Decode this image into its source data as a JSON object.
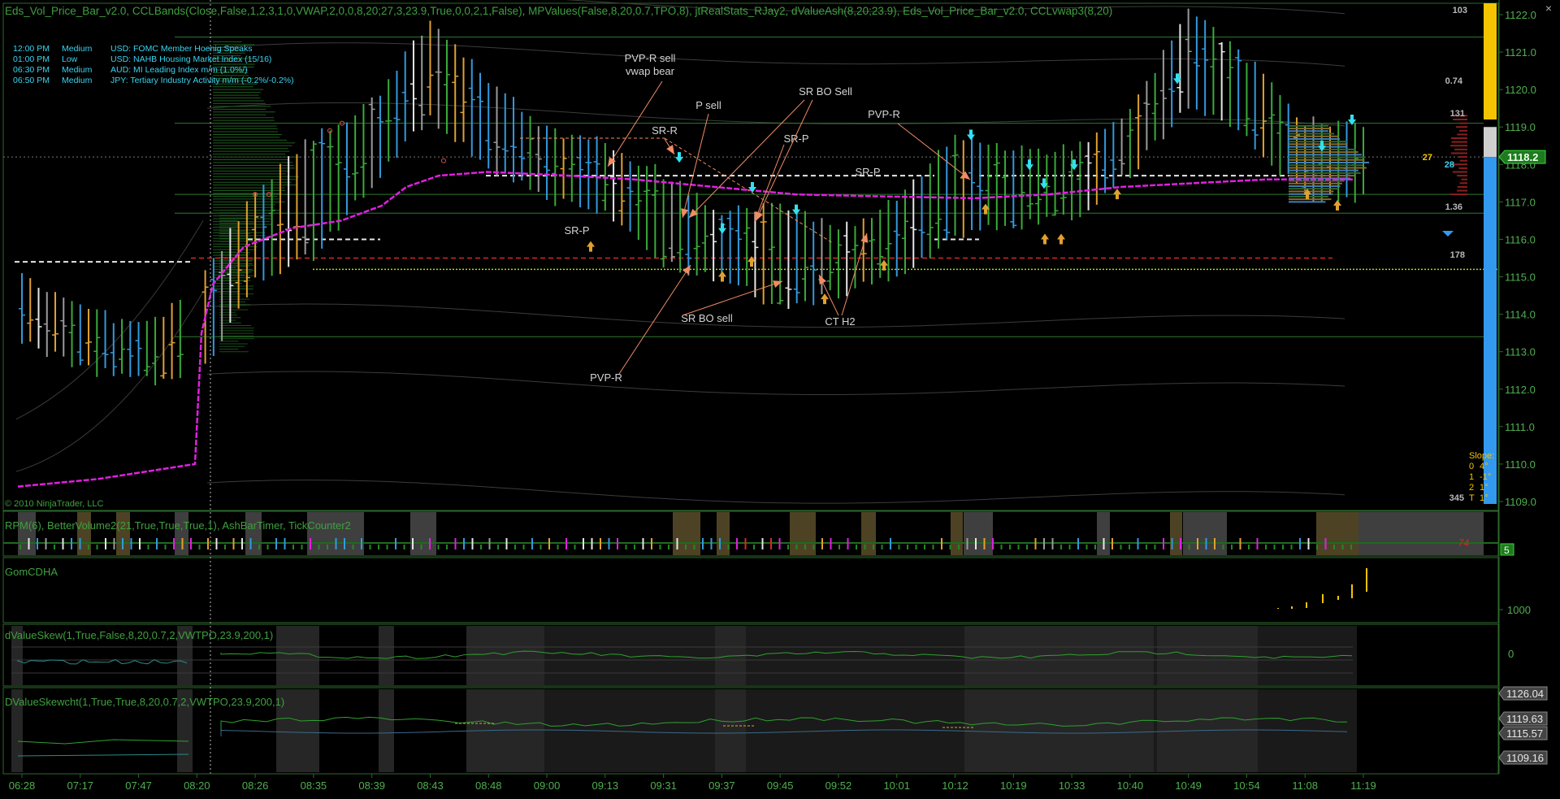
{
  "header": {
    "indicators": "Eds_Vol_Price_Bar_v2.0, CCLBands(Close,False,1,2,3,1,0,VWAP,2,0,0,8,20;27,3,23.9,True,0,0,2,1,False), MPValues(False,8,20,0.7,TPO,8), jtRealStats_RJay2, dValueAsh(8,20;23.9), Eds_Vol_Price_Bar_v2.0, CCLvwap3(8,20)",
    "copyright": "© 2010 NinjaTrader, LLC"
  },
  "news": [
    {
      "time": "12:00 PM",
      "impact": "Medium",
      "text": "USD: FOMC Member Hoenig Speaks"
    },
    {
      "time": "01:00 PM",
      "impact": "Low",
      "text": "USD: NAHB Housing Market Index (15/16)"
    },
    {
      "time": "06:30 PM",
      "impact": "Medium",
      "text": "AUD: MI Leading Index m/m (1.0%/)"
    },
    {
      "time": "06:50 PM",
      "impact": "Medium",
      "text": "JPY: Tertiary Industry Activity m/m (-0.2%/-0.2%)"
    }
  ],
  "right_stats": {
    "top": "103",
    "v1": "0.74",
    "v2": "131",
    "v3": "27",
    "v4": "28",
    "v5": "1.36",
    "v6": "178",
    "v7": "345",
    "v7b": "T",
    "v7c": "1°"
  },
  "slope": {
    "label": "Slope:",
    "rows": [
      [
        "0",
        "4°"
      ],
      [
        "1",
        "-1°"
      ],
      [
        "2",
        "1°"
      ]
    ]
  },
  "panels": {
    "p2": {
      "title": "RPM(6), BetterVolume2(21,True,True,True,1), AshBarTimer, TickCounter2",
      "badge": "5",
      "timer": "74"
    },
    "p3": {
      "title": "GomCDHA",
      "label": "1000"
    },
    "p4": {
      "title": "dValueSkew(1,True,False,8,20,0.7,2,VWTPO,23.9,200,1)",
      "label": "0"
    },
    "p5": {
      "title": "DValueSkewcht(1,True,True,8,20,0.7,2,VWTPO,23.9,200,1)",
      "labels": [
        "1126.04",
        "1119.63",
        "1115.57",
        "1109.16"
      ]
    }
  },
  "colors": {
    "green": "#3aaa3a",
    "blue": "#3399dd",
    "white": "#e6e6e6",
    "orange": "#e0a030",
    "red": "#d62828",
    "magenta": "#e020e0",
    "lime": "#a8d830",
    "salmon": "#f08c64",
    "cyan": "#33e0f0",
    "yellow": "#f4c400",
    "gray": "#9a9a9a"
  },
  "chart_data": {
    "type": "ohlc",
    "ylim": [
      1109,
      1122
    ],
    "y_ticks": [
      "1109.0",
      "1110.0",
      "1111.0",
      "1112.0",
      "1113.0",
      "1114.0",
      "1115.0",
      "1116.0",
      "1117.0",
      "1118.0",
      "1119.0",
      "1120.0",
      "1121.0",
      "1122.0"
    ],
    "current_price": "1118.2",
    "x_ticks": [
      "06:28",
      "07:17",
      "07:47",
      "08:20",
      "08:26",
      "08:35",
      "08:39",
      "08:43",
      "08:48",
      "09:00",
      "09:13",
      "09:31",
      "09:37",
      "09:45",
      "09:52",
      "10:01",
      "10:12",
      "10:19",
      "10:33",
      "10:40",
      "10:49",
      "10:54",
      "11:08",
      "11:19"
    ],
    "annotations": [
      {
        "text": "PVP-R sell",
        "x": "09:13",
        "y": 1120.9
      },
      {
        "text": "vwap bear",
        "x": "09:13",
        "y": 1120.6
      },
      {
        "text": "P sell",
        "x": "09:31",
        "y": 1119.6
      },
      {
        "text": "SR BO Sell",
        "x": "09:45",
        "y": 1119.9
      },
      {
        "text": "SR-R",
        "x": "09:13",
        "y": 1118.8
      },
      {
        "text": "SR-P",
        "x": "09:45",
        "y": 1118.6
      },
      {
        "text": "PVP-R",
        "x": "10:01",
        "y": 1119.1
      },
      {
        "text": "SR-P",
        "x": "10:01",
        "y": 1117.6
      },
      {
        "text": "SR-P",
        "x": "09:00",
        "y": 1116.1
      },
      {
        "text": "SR BO sell",
        "x": "09:31",
        "y": 1114.2
      },
      {
        "text": "CT H2",
        "x": "09:52",
        "y": 1113.9
      },
      {
        "text": "PVP-R",
        "x": "09:13",
        "y": 1112.7
      }
    ],
    "levels": [
      {
        "name": "white-dashed",
        "values": [
          1115.4,
          1116.0,
          1117.7
        ]
      },
      {
        "name": "red-dashed",
        "values": [
          1115.5
        ]
      },
      {
        "name": "yellow-dotted",
        "values": [
          1115.2
        ]
      },
      {
        "name": "green-lines",
        "values": [
          1113.4,
          1116.7,
          1117.2,
          1119.1,
          1121.4
        ]
      }
    ],
    "ohlc_samples": [
      {
        "t": "06:28",
        "o": 1114.2,
        "h": 1114.8,
        "l": 1113.5,
        "c": 1113.8
      },
      {
        "t": "07:17",
        "o": 1113.5,
        "h": 1114.1,
        "l": 1112.7,
        "c": 1113.0
      },
      {
        "t": "07:47",
        "o": 1113.0,
        "h": 1113.5,
        "l": 1112.4,
        "c": 1112.9
      },
      {
        "t": "08:20",
        "o": 1112.8,
        "h": 1114.5,
        "l": 1112.4,
        "c": 1114.4
      },
      {
        "t": "08:26",
        "o": 1115.3,
        "h": 1117.2,
        "l": 1115.1,
        "c": 1116.8
      },
      {
        "t": "08:35",
        "o": 1116.0,
        "h": 1118.6,
        "l": 1115.7,
        "c": 1118.2
      },
      {
        "t": "08:39",
        "o": 1117.9,
        "h": 1119.5,
        "l": 1117.6,
        "c": 1119.3
      },
      {
        "t": "08:43",
        "o": 1119.8,
        "h": 1121.7,
        "l": 1119.4,
        "c": 1120.3
      },
      {
        "t": "08:48",
        "o": 1119.6,
        "h": 1120.1,
        "l": 1118.1,
        "c": 1118.5
      },
      {
        "t": "09:00",
        "o": 1118.4,
        "h": 1118.8,
        "l": 1117.2,
        "c": 1117.6
      },
      {
        "t": "09:13",
        "o": 1117.9,
        "h": 1118.4,
        "l": 1116.9,
        "c": 1117.2
      },
      {
        "t": "09:31",
        "o": 1117.0,
        "h": 1117.6,
        "l": 1115.5,
        "c": 1115.8
      },
      {
        "t": "09:37",
        "o": 1115.8,
        "h": 1116.6,
        "l": 1115.1,
        "c": 1116.2
      },
      {
        "t": "09:45",
        "o": 1116.1,
        "h": 1116.8,
        "l": 1114.3,
        "c": 1114.7
      },
      {
        "t": "09:52",
        "o": 1114.9,
        "h": 1116.1,
        "l": 1114.7,
        "c": 1115.9
      },
      {
        "t": "10:01",
        "o": 1115.6,
        "h": 1116.9,
        "l": 1115.1,
        "c": 1116.4
      },
      {
        "t": "10:12",
        "o": 1116.6,
        "h": 1118.6,
        "l": 1116.3,
        "c": 1117.9
      },
      {
        "t": "10:19",
        "o": 1117.6,
        "h": 1118.2,
        "l": 1116.5,
        "c": 1116.9
      },
      {
        "t": "10:33",
        "o": 1117.0,
        "h": 1118.3,
        "l": 1116.7,
        "c": 1118.1
      },
      {
        "t": "10:40",
        "o": 1118.1,
        "h": 1119.3,
        "l": 1117.9,
        "c": 1119.2
      },
      {
        "t": "10:49",
        "o": 1120.0,
        "h": 1121.9,
        "l": 1119.7,
        "c": 1121.3
      },
      {
        "t": "10:54",
        "o": 1120.4,
        "h": 1120.7,
        "l": 1118.9,
        "c": 1119.1
      },
      {
        "t": "11:08",
        "o": 1118.9,
        "h": 1119.0,
        "l": 1117.3,
        "c": 1117.8
      },
      {
        "t": "11:19",
        "o": 1118.1,
        "h": 1119.0,
        "l": 1117.2,
        "c": 1118.2
      }
    ]
  }
}
